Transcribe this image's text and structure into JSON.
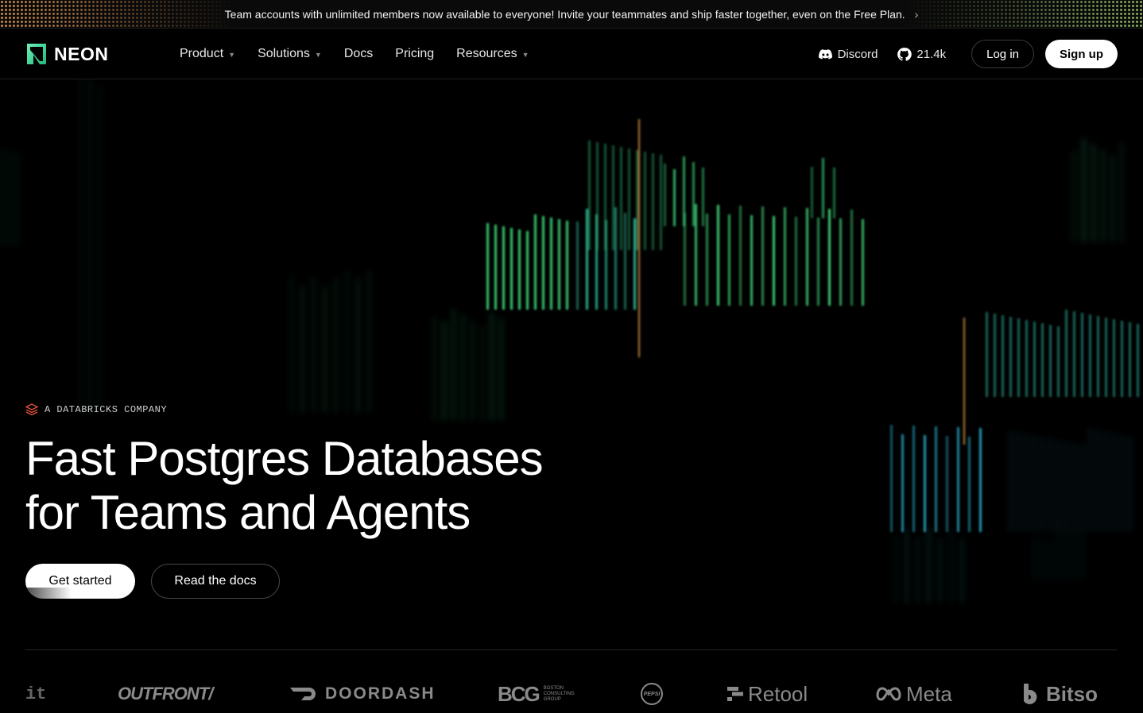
{
  "announcement": {
    "text": "Team accounts with unlimited members now available to everyone! Invite your teammates and ship faster together, even on the Free Plan."
  },
  "header": {
    "brand": "NEON",
    "nav": [
      {
        "label": "Product",
        "has_menu": true
      },
      {
        "label": "Solutions",
        "has_menu": true
      },
      {
        "label": "Docs",
        "has_menu": false
      },
      {
        "label": "Pricing",
        "has_menu": false
      },
      {
        "label": "Resources",
        "has_menu": true
      }
    ],
    "discord_label": "Discord",
    "github_stars": "21.4k",
    "login_label": "Log in",
    "signup_label": "Sign up"
  },
  "hero": {
    "eyebrow": "A DATABRICKS COMPANY",
    "title_line1": "Fast Postgres Databases",
    "title_line2": "for Teams and Agents",
    "primary_cta": "Get started",
    "secondary_cta": "Read the docs"
  },
  "customer_logos": [
    "it",
    "OUTFRONT/",
    "DOORDASH",
    "BCG",
    "BOSTON",
    "CONSULTING",
    "GROUP",
    "PEPSI",
    "Retool",
    "Meta",
    "Bitso"
  ],
  "colors": {
    "brand_green": "#34d59a",
    "background": "#000000",
    "accent_orange": "#e5a24a"
  }
}
